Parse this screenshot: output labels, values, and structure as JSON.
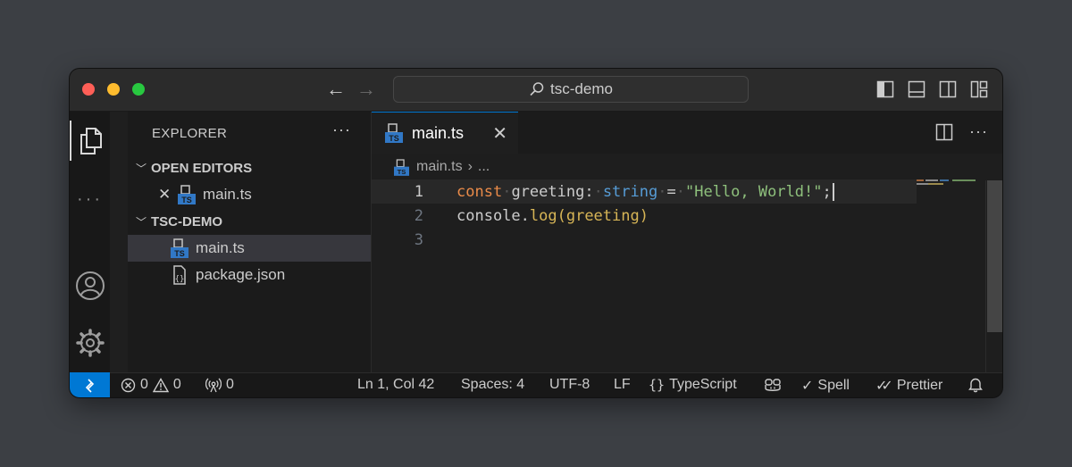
{
  "titlebar": {
    "search_text": "tsc-demo"
  },
  "sidebar": {
    "header": "EXPLORER",
    "more": "···",
    "open_editors_label": "OPEN EDITORS",
    "open_editors": [
      {
        "name": "main.ts"
      }
    ],
    "folder_label": "TSC-DEMO",
    "files": [
      {
        "name": "main.ts"
      },
      {
        "name": "package.json"
      }
    ]
  },
  "editor": {
    "tab_label": "main.ts",
    "breadcrumb_file": "main.ts",
    "breadcrumb_more": "...",
    "line_numbers": [
      "1",
      "2",
      "3"
    ],
    "code": {
      "line1": {
        "kw": "const",
        "name": "greeting:",
        "type": "string",
        "op": "=",
        "str": "\"Hello, World!\"",
        "end": ";"
      },
      "line2": {
        "obj": "console.",
        "fn": "log",
        "args": "(greeting)"
      }
    }
  },
  "statusbar": {
    "errors": "0",
    "warnings": "0",
    "ports": "0",
    "position": "Ln 1, Col 42",
    "spaces": "Spaces: 4",
    "encoding": "UTF-8",
    "eol": "LF",
    "language": "TypeScript",
    "spell": "Spell",
    "prettier": "Prettier"
  },
  "colors": {
    "accent": "#0078d4",
    "keyword": "#ea8b49",
    "type": "#569cd6",
    "string": "#8ec07c",
    "function": "#d7b556",
    "ts_icon": "#3178c6"
  }
}
